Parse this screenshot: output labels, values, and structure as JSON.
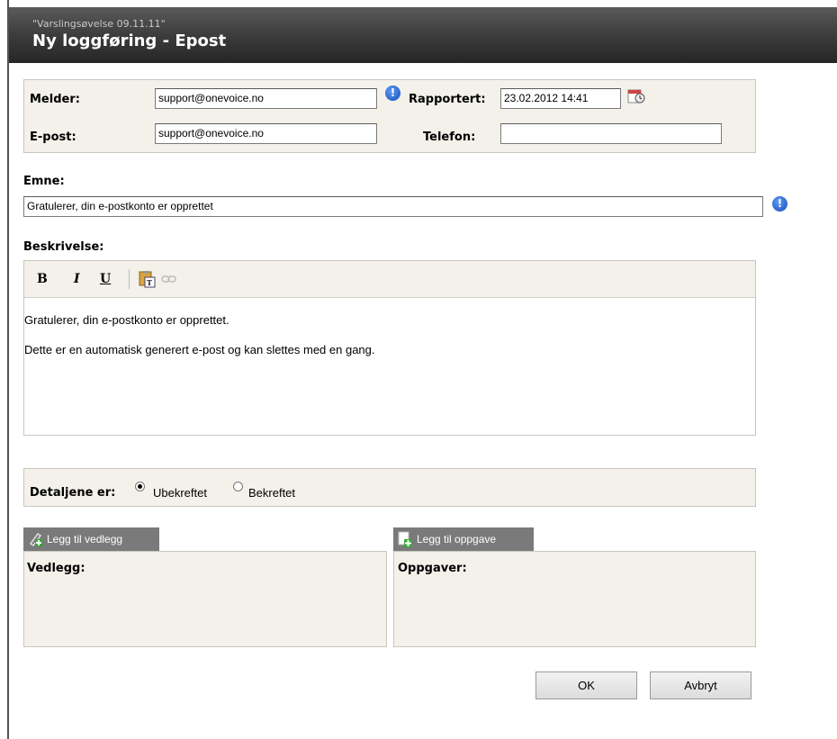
{
  "header": {
    "subtitle": "\"Varslingsøvelse 09.11.11\"",
    "title": "Ny loggføring - Epost"
  },
  "reporter": {
    "melder_label": "Melder:",
    "melder_value": "support@onevoice.no",
    "epost_label": "E-post:",
    "epost_value": "support@onevoice.no",
    "rapportert_label": "Rapportert:",
    "rapportert_value": "23.02.2012 14:41",
    "telefon_label": "Telefon:",
    "telefon_value": ""
  },
  "subject": {
    "label": "Emne:",
    "value": "Gratulerer, din e-postkonto er opprettet"
  },
  "description": {
    "label": "Beskrivelse:",
    "toolbar": {
      "bold": "B",
      "italic": "I",
      "underline": "U"
    },
    "lines": [
      "Gratulerer, din e-postkonto er opprettet.",
      "Dette er en automatisk generert e-post og kan slettes med en gang."
    ]
  },
  "details": {
    "label": "Detaljene er:",
    "options": [
      "Ubekreftet",
      "Bekreftet"
    ],
    "selected": "Ubekreftet"
  },
  "attachments": {
    "button": "Legg til vedlegg",
    "heading": "Vedlegg:"
  },
  "tasks": {
    "button": "Legg til oppgave",
    "heading": "Oppgaver:"
  },
  "actions": {
    "ok": "OK",
    "cancel": "Avbryt"
  },
  "icons": {
    "info": "info-icon",
    "calendar": "calendar-icon",
    "paste": "paste-text-icon",
    "link": "link-icon"
  }
}
